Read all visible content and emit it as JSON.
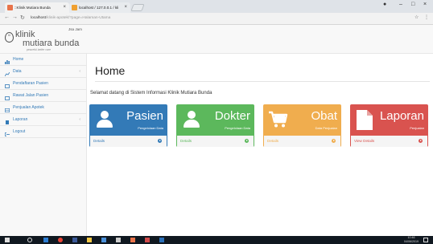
{
  "browser": {
    "tabs": [
      {
        "title": "::Klinik Mutiara Bunda",
        "active": true
      },
      {
        "title": "localhost / 127.0.0.1 / kli",
        "active": false
      }
    ],
    "url_host": "localhost",
    "url_path": "/klinik-apotek/?page=Halaman-Utama"
  },
  "sidebar": {
    "time_label": "Jsa Jam",
    "logo": {
      "line1": "klinik",
      "line2": "mutiara bunda",
      "tagline": "peaceful better care"
    },
    "items": [
      {
        "label": "Home",
        "icon": "dashboard-icon",
        "has_chevron": false,
        "color": "#337ab7"
      },
      {
        "label": "Data",
        "icon": "chart-icon",
        "has_chevron": true,
        "color": "#337ab7"
      },
      {
        "label": "Pendaftaran Pasien",
        "icon": "edit-icon",
        "has_chevron": false,
        "color": "#337ab7"
      },
      {
        "label": "Rawat Jalan Pasien",
        "icon": "edit-icon",
        "has_chevron": false,
        "color": "#337ab7"
      },
      {
        "label": "Penjualan Apotek",
        "icon": "table-icon",
        "has_chevron": false,
        "color": "#337ab7"
      },
      {
        "label": "Laporan",
        "icon": "file-icon",
        "has_chevron": true,
        "color": "#337ab7"
      },
      {
        "label": "Logout",
        "icon": "logout-icon",
        "has_chevron": false,
        "color": "#337ab7"
      }
    ]
  },
  "main": {
    "title": "Home",
    "welcome": "Selamat datang di Sistem Informasi Klinik Mutiara Bunda",
    "panels": [
      {
        "title": "Pasien",
        "subtitle": "Pengelolaan Data",
        "link": "Details",
        "icon": "user-icon",
        "color": "#337ab7",
        "border": "#337ab7",
        "link_color": "#337ab7"
      },
      {
        "title": "Dokter",
        "subtitle": "Pengelolaan Data",
        "link": "Details",
        "icon": "user-icon",
        "color": "#5cb85c",
        "border": "#5cb85c",
        "link_color": "#5cb85c"
      },
      {
        "title": "Obat",
        "subtitle": "Data Penjualan",
        "link": "Details",
        "icon": "cart-icon",
        "color": "#f0ad4e",
        "border": "#f0ad4e",
        "link_color": "#f0ad4e"
      },
      {
        "title": "Laporan",
        "subtitle": "Penjualan",
        "link": "View Details",
        "icon": "document-icon",
        "color": "#d9534f",
        "border": "#d9534f",
        "link_color": "#d9534f"
      }
    ]
  },
  "taskbar": {
    "time": "10:46",
    "date": "04/06/2019"
  }
}
